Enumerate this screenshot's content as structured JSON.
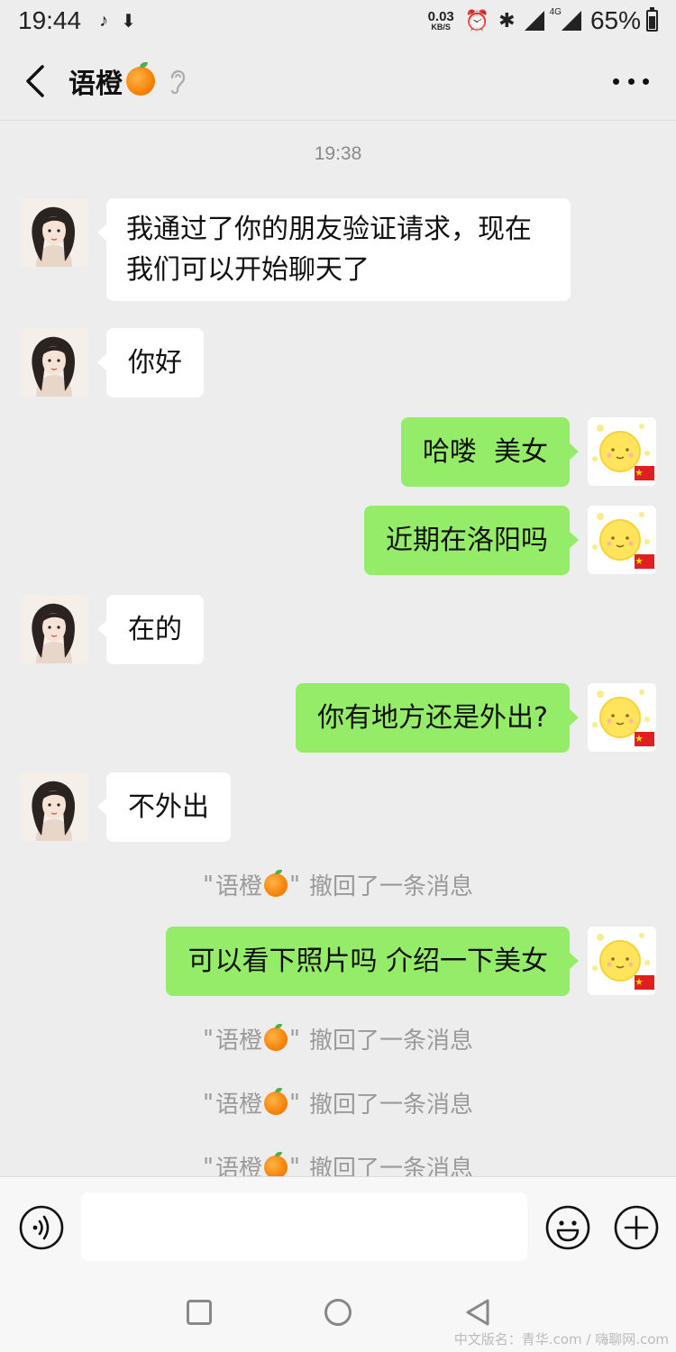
{
  "status_bar": {
    "time": "19:44",
    "net_speed_value": "0.03",
    "net_speed_unit": "KB/S",
    "network_type": "4G",
    "battery": "65%"
  },
  "header": {
    "title": "语橙"
  },
  "chat": {
    "timestamp": "19:38",
    "messages": [
      {
        "side": "left",
        "text_line1": "我通过了你的朋友验证请求，现在",
        "text_line2": "我们可以开始聊天了"
      },
      {
        "side": "left",
        "text": "你好"
      },
      {
        "side": "right",
        "text": "哈喽  美女"
      },
      {
        "side": "right",
        "text": "近期在洛阳吗"
      },
      {
        "side": "left",
        "text": "在的"
      },
      {
        "side": "right",
        "text": "你有地方还是外出?"
      },
      {
        "side": "left",
        "text": "不外出"
      },
      {
        "side": "right",
        "text": "可以看下照片吗 介绍一下美女"
      }
    ],
    "recall": {
      "name": "语橙",
      "quote_open": "\"",
      "quote_close": "\"",
      "suffix": "撤回了一条消息"
    }
  },
  "watermark": "中文版名：青华.com / 嗨聊网.com",
  "colors": {
    "background": "#ededed",
    "sent_bubble": "#95ec69",
    "received_bubble": "#ffffff",
    "system_text": "#9a9a9a"
  }
}
